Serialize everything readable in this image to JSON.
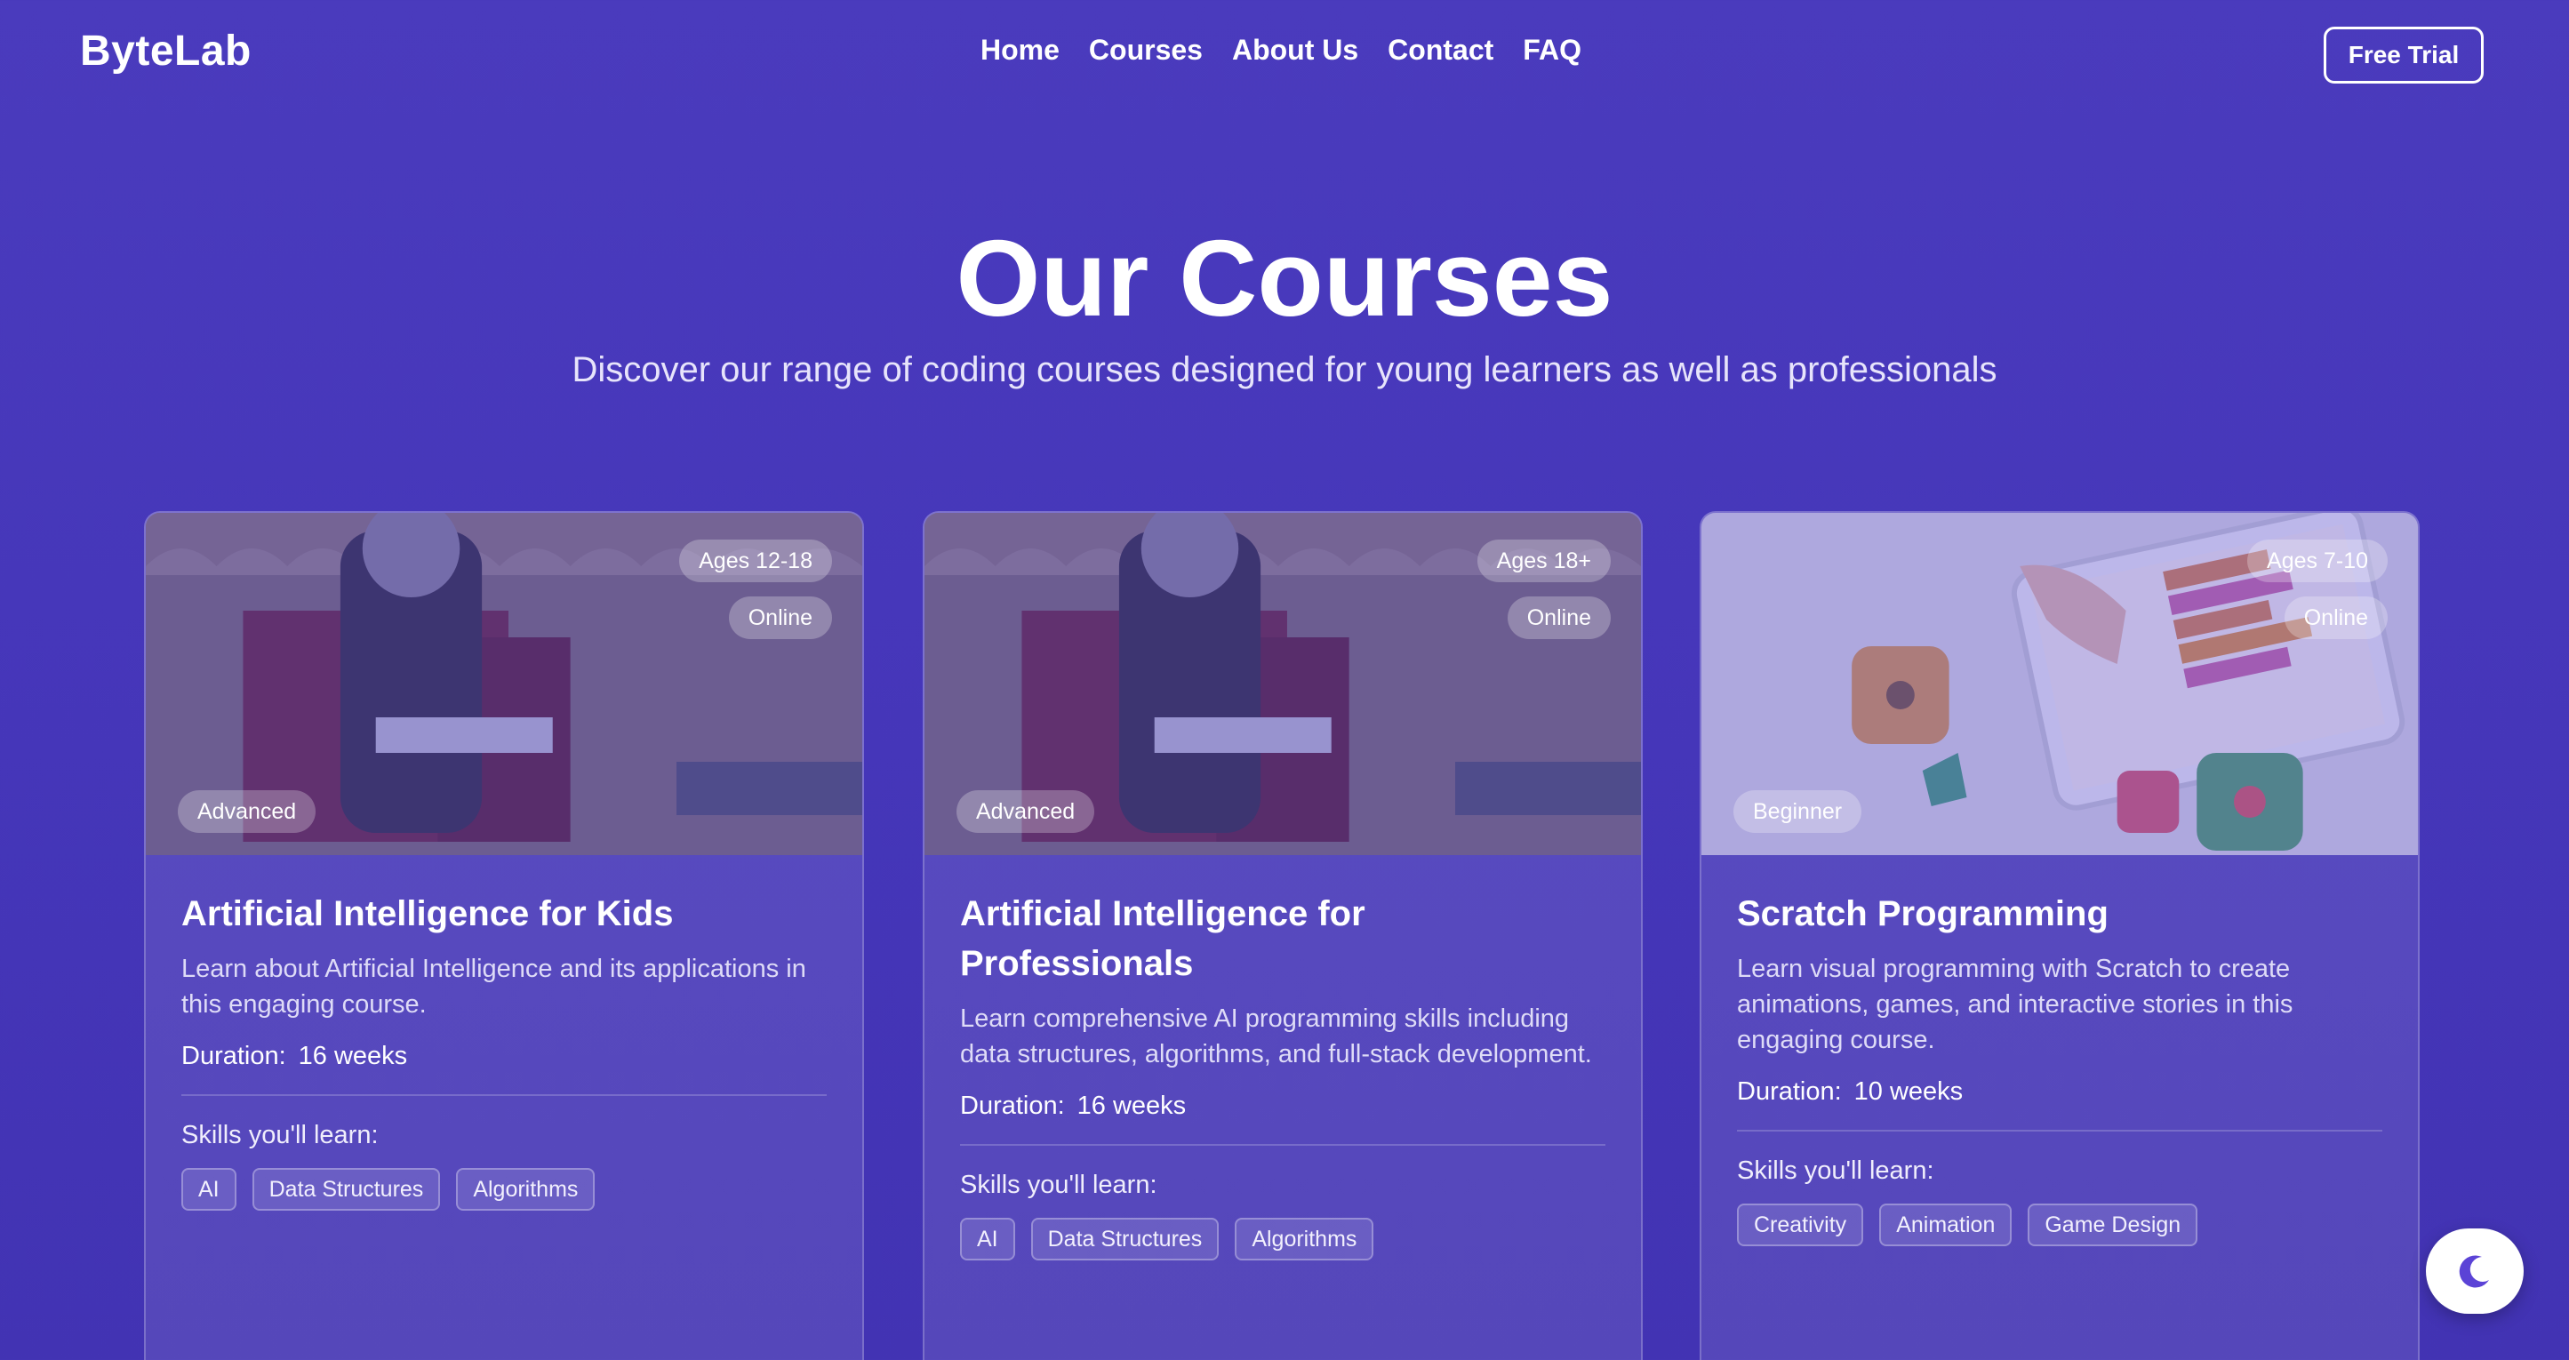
{
  "nav": {
    "logo": "ByteLab",
    "links": [
      "Home",
      "Courses",
      "About Us",
      "Contact",
      "FAQ"
    ],
    "cta": "Free Trial"
  },
  "hero": {
    "title": "Our Courses",
    "subtitle": "Discover our range of coding courses designed for young learners as well as professionals"
  },
  "labels": {
    "duration": "Duration:",
    "skills": "Skills you'll learn:"
  },
  "courses": [
    {
      "title": "Artificial Intelligence for Kids",
      "description": "Learn about Artificial Intelligence and its applications in this engaging course.",
      "duration": "16 weeks",
      "age": "Ages 12-18",
      "mode": "Online",
      "level": "Advanced",
      "image": "robot-on-bench-image",
      "skills": [
        "AI",
        "Data Structures",
        "Algorithms"
      ]
    },
    {
      "title": "Artificial Intelligence for Professionals",
      "description": "Learn comprehensive AI programming skills including data structures, algorithms, and full-stack development.",
      "duration": "16 weeks",
      "age": "Ages 18+",
      "mode": "Online",
      "level": "Advanced",
      "image": "robot-on-bench-image",
      "skills": [
        "AI",
        "Data Structures",
        "Algorithms"
      ]
    },
    {
      "title": "Scratch Programming",
      "description": "Learn visual programming with Scratch to create animations, games, and interactive stories in this engaging course.",
      "duration": "10 weeks",
      "age": "Ages 7-10",
      "mode": "Online",
      "level": "Beginner",
      "image": "tablet-scratch-image",
      "skills": [
        "Creativity",
        "Animation",
        "Game Design"
      ]
    }
  ],
  "theme_toggle": {
    "icon": "moon-icon"
  },
  "colors": {
    "background": "#4a3bbd",
    "accent": "#5b43d6"
  }
}
